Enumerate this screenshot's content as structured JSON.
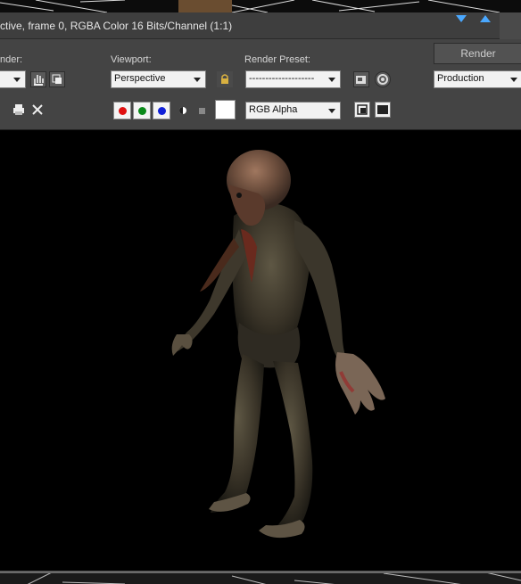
{
  "window": {
    "title": "ctive, frame 0, RGBA Color 16 Bits/Channel (1:1)"
  },
  "toolbar": {
    "area_to_render_label": "nder:",
    "viewport_label": "Viewport:",
    "viewport_value": "Perspective",
    "render_preset_label": "Render Preset:",
    "render_preset_value": "--------------------",
    "render_button": "Render",
    "production_value": "Production",
    "channel_display_value": "RGB Alpha"
  },
  "channels": {
    "red": "#e01010",
    "green": "#0a8a1a",
    "blue": "#1020d8"
  },
  "icons": [
    "hand-icon",
    "copy-icon",
    "lock-icon",
    "save-image-icon",
    "settings-icon",
    "print-icon",
    "clear-icon",
    "mono-icon",
    "display-icon",
    "fullscreen-icon"
  ]
}
